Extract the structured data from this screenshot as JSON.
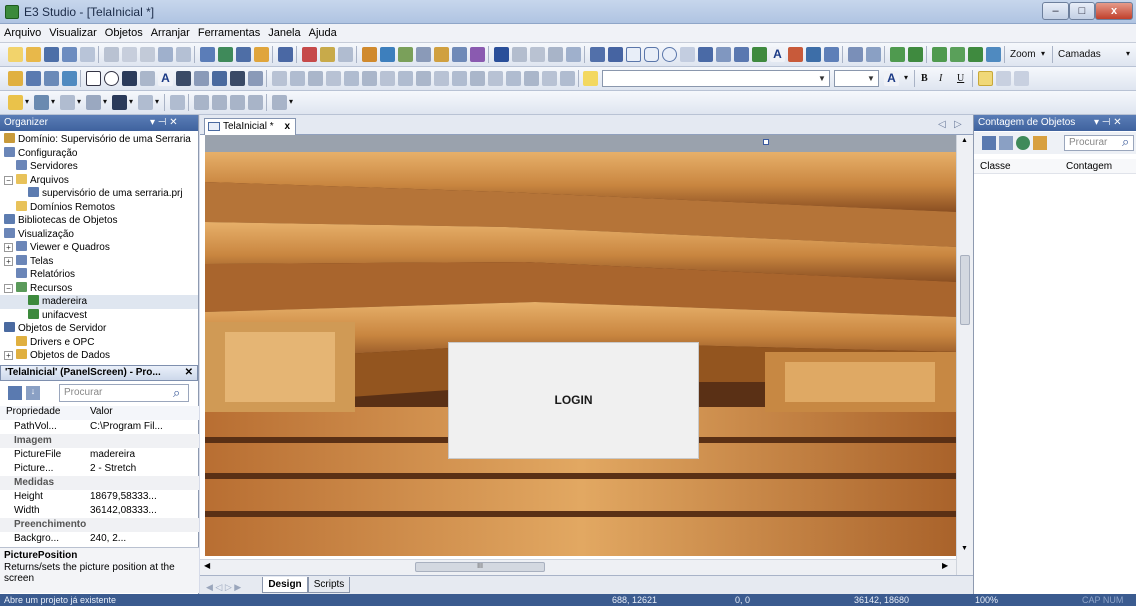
{
  "window": {
    "title": "E3 Studio - [TelaInicial *]",
    "min": "–",
    "max": "□",
    "close": "x"
  },
  "menu": [
    "Arquivo",
    "Visualizar",
    "Objetos",
    "Arranjar",
    "Ferramentas",
    "Janela",
    "Ajuda"
  ],
  "toolbar": {
    "zoom": "Zoom",
    "layers": "Camadas",
    "font_bold": "B",
    "font_italic": "I",
    "font_underline": "U",
    "text_tool": "A"
  },
  "organizer": {
    "title": "Organizer",
    "tree": [
      {
        "label": "Domínio: Supervisório de uma Serraria",
        "level": 0,
        "icon": "domain-icon",
        "color": "#c89a3a"
      },
      {
        "label": "Configuração",
        "level": 0,
        "icon": "config-icon",
        "color": "#6b86b8"
      },
      {
        "label": "Servidores",
        "level": 1,
        "icon": "servers-icon",
        "color": "#6b86b8"
      },
      {
        "label": "Arquivos",
        "level": 0,
        "icon": "folder-icon",
        "color": "#e8c25a",
        "expander": "−"
      },
      {
        "label": "supervisório de uma serraria.prj",
        "level": 2,
        "icon": "project-file-icon",
        "color": "#5d7cb0"
      },
      {
        "label": "Domínios Remotos",
        "level": 1,
        "icon": "folder-icon",
        "color": "#e8c25a"
      },
      {
        "label": "Bibliotecas de Objetos",
        "level": 0,
        "icon": "library-icon",
        "color": "#5d7cb0"
      },
      {
        "label": "Visualização",
        "level": 0,
        "icon": "view-icon",
        "color": "#6b86b8"
      },
      {
        "label": "Viewer e Quadros",
        "level": 0,
        "icon": "viewer-icon",
        "color": "#6b86b8",
        "expander": "+"
      },
      {
        "label": "Telas",
        "level": 0,
        "icon": "screens-icon",
        "color": "#6b86b8",
        "expander": "+"
      },
      {
        "label": "Relatórios",
        "level": 1,
        "icon": "report-icon",
        "color": "#6b86b8"
      },
      {
        "label": "Recursos",
        "level": 0,
        "icon": "resources-icon",
        "color": "#5a9a5a",
        "expander": "−"
      },
      {
        "label": "madereira",
        "level": 2,
        "icon": "image-resource-icon",
        "color": "#3d8a3d",
        "selected": true
      },
      {
        "label": "unifacvest",
        "level": 2,
        "icon": "image-resource-icon",
        "color": "#3d8a3d"
      },
      {
        "label": "Objetos de Servidor",
        "level": 0,
        "icon": "server-objects-icon",
        "color": "#4a6aa0"
      },
      {
        "label": "Drivers e OPC",
        "level": 1,
        "icon": "drivers-icon",
        "color": "#e0b040"
      },
      {
        "label": "Objetos de Dados",
        "level": 0,
        "icon": "data-objects-icon",
        "color": "#e0b040",
        "expander": "+"
      }
    ]
  },
  "properties": {
    "title": "'TelaInicial' (PanelScreen) - Pro...",
    "search_placeholder": "Procurar",
    "col_property": "Propriedade",
    "col_value": "Valor",
    "rows": [
      {
        "name": "PathVol...",
        "value": "C:\\Program Fil...",
        "category": false
      },
      {
        "name": "Imagem",
        "value": "",
        "category": true
      },
      {
        "name": "PictureFile",
        "value": "madereira",
        "category": false
      },
      {
        "name": "Picture...",
        "value": "2 - Stretch",
        "category": false
      },
      {
        "name": "Medidas",
        "value": "",
        "category": true
      },
      {
        "name": "Height",
        "value": "18679,58333...",
        "category": false
      },
      {
        "name": "Width",
        "value": "36142,08333...",
        "category": false
      },
      {
        "name": "Preenchimento",
        "value": "",
        "category": true
      },
      {
        "name": "Backgro...",
        "value": "240, 2...",
        "category": false
      }
    ],
    "desc_title": "PicturePosition",
    "desc_text": "Returns/sets the picture position at the screen"
  },
  "document": {
    "tab_label": "TelaInicial *",
    "tab_close": "x",
    "login_label": "LOGIN",
    "bottom_tabs": [
      "Design",
      "Scripts"
    ],
    "hscroll_mark": "III"
  },
  "counter": {
    "title": "Contagem de Objetos",
    "search_placeholder": "Procurar",
    "col_class": "Classe",
    "col_count": "Contagem"
  },
  "status": {
    "message": "Abre um projeto já existente",
    "cursor": "688, 12621",
    "size": "0, 0",
    "dimensions": "36142, 18680",
    "zoom": "100%",
    "indicators": "CAP NUM SCR"
  },
  "colors": {
    "accent": "#3f629e",
    "wood_dark": "#6b3d1b",
    "wood_light": "#d9a05a"
  }
}
